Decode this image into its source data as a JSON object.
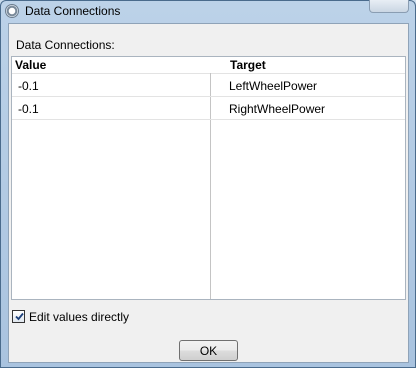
{
  "window": {
    "title": "Data Connections",
    "icon": "gear-icon"
  },
  "section_label": "Data Connections:",
  "grid": {
    "columns": [
      "Value",
      "Target"
    ],
    "rows": [
      {
        "value": "-0.1",
        "target": "LeftWheelPower"
      },
      {
        "value": "-0.1",
        "target": "RightWheelPower"
      }
    ]
  },
  "edit_checkbox": {
    "label": "Edit values directly",
    "checked": true
  },
  "ok_button": {
    "label": "OK"
  }
}
